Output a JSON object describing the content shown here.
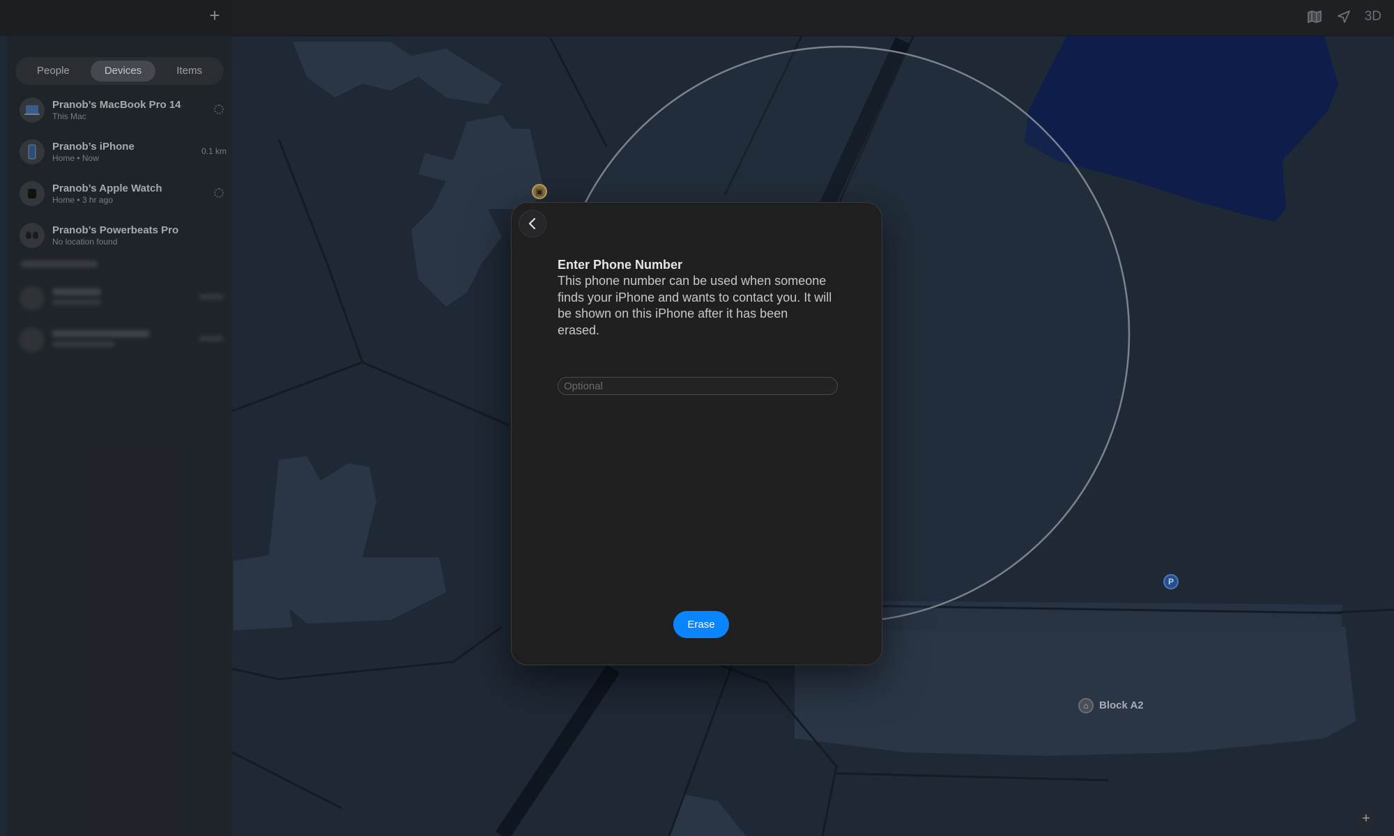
{
  "toolbar": {
    "add_icon": "plus-icon",
    "map_icon": "map-icon",
    "location_icon": "location-arrow-icon",
    "view_3d_label": "3D"
  },
  "sidebar": {
    "tabs": [
      {
        "label": "People",
        "active": false
      },
      {
        "label": "Devices",
        "active": true
      },
      {
        "label": "Items",
        "active": false
      }
    ],
    "devices": [
      {
        "name": "Pranob’s MacBook Pro 14",
        "subtitle": "This Mac",
        "meta": ""
      },
      {
        "name": "Pranob’s iPhone",
        "subtitle": "Home • Now",
        "meta": "0.1 km"
      },
      {
        "name": "Pranob’s Apple Watch",
        "subtitle": "Home • 3 hr ago",
        "meta": ""
      },
      {
        "name": "Pranob’s Powerbeats Pro",
        "subtitle": "No location found",
        "meta": ""
      }
    ]
  },
  "modal": {
    "title": "Enter Phone Number",
    "description": "This phone number can be used when someone finds your iPhone and wants to contact you. It will be shown on this iPhone after it has been erased.",
    "phone_placeholder": "Optional",
    "phone_value": "",
    "erase_label": "Erase",
    "accent_color": "#0a84ff"
  },
  "map": {
    "labels": {
      "block": "Block A2",
      "parking": "P"
    }
  }
}
